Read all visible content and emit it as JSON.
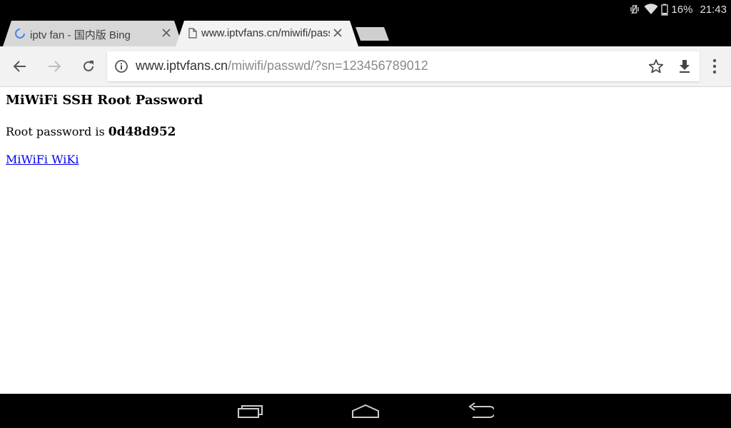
{
  "status": {
    "battery": "16%",
    "time": "21:43",
    "icons": [
      "vibrate-off-icon",
      "wifi-icon",
      "battery-icon"
    ]
  },
  "tabs": [
    {
      "title": "iptv fan - 国内版 Bing",
      "active": false,
      "icon": "loading-spinner-icon"
    },
    {
      "title": "www.iptvfans.cn/miwifi/passwd",
      "active": true,
      "icon": "page-icon"
    }
  ],
  "toolbar": {
    "url_host": "www.iptvfans.cn",
    "url_path": "/miwifi/passwd/?sn=123456789012"
  },
  "page": {
    "heading": "MiWiFi SSH Root Password",
    "password_label": "Root password is ",
    "password_value": "0d48d952",
    "wiki_link": "MiWiFi WiKi"
  },
  "colors": {
    "accent_spinner": "#4285f4",
    "link": "#0000ee"
  }
}
